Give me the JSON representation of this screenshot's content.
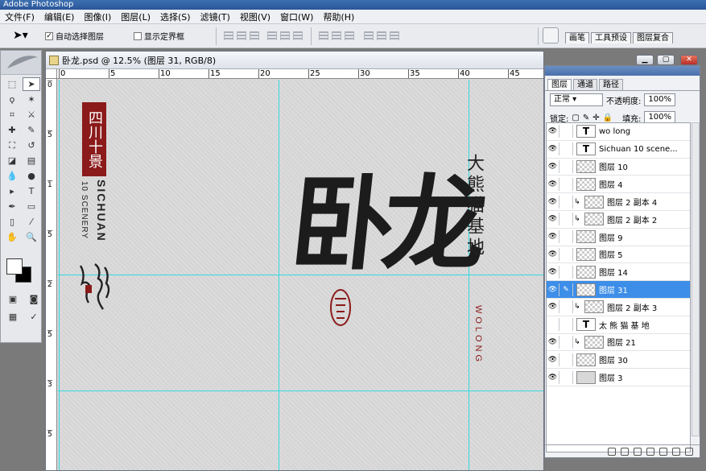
{
  "app": {
    "title": "Adobe Photoshop"
  },
  "menu": [
    "文件(F)",
    "编辑(E)",
    "图像(I)",
    "图层(L)",
    "选择(S)",
    "滤镜(T)",
    "视图(V)",
    "窗口(W)",
    "帮助(H)"
  ],
  "options": {
    "auto_select": "自动选择图层",
    "show_bounds": "显示定界框"
  },
  "palette_tabs": [
    "画笔",
    "工具预设",
    "图层复合"
  ],
  "document": {
    "title": "卧龙.psd @ 12.5% (图层 31, RGB/8)",
    "ruler_h": [
      "0",
      "5",
      "10",
      "15",
      "20",
      "25",
      "30",
      "35",
      "40",
      "45"
    ],
    "ruler_v": [
      "0",
      "5",
      "1",
      "5",
      "2",
      "5",
      "3",
      "5"
    ]
  },
  "artwork": {
    "sichuan_logo": "四川十景",
    "sichuan_en": "SICHUAN",
    "scenery_en": "10 SCENERY",
    "big_chars": "卧龙",
    "side_chars": "大熊猫基地",
    "wolong_en": "WOLONG"
  },
  "layers_panel": {
    "tabs": [
      "图层",
      "通道",
      "路径"
    ],
    "blend_mode": "正常",
    "opacity_label": "不透明度:",
    "opacity_value": "100%",
    "lock_label": "锁定:",
    "fill_label": "填充:",
    "fill_value": "100%",
    "layers": [
      {
        "name": "wo long",
        "type": "text",
        "visible": true
      },
      {
        "name": "Sichuan  10 scene...",
        "type": "text",
        "visible": true
      },
      {
        "name": "图层 10",
        "type": "pixel",
        "visible": true
      },
      {
        "name": "图层 4",
        "type": "pixel",
        "visible": true
      },
      {
        "name": "图层 2 副本 4",
        "type": "pixel",
        "visible": true,
        "clipped": true
      },
      {
        "name": "图层 2 副本 2",
        "type": "pixel",
        "visible": true,
        "clipped": true
      },
      {
        "name": "图层 9",
        "type": "pixel",
        "visible": true
      },
      {
        "name": "图层 5",
        "type": "pixel",
        "visible": true
      },
      {
        "name": "图层 14",
        "type": "pixel",
        "visible": true
      },
      {
        "name": "图层 31",
        "type": "pixel",
        "visible": true,
        "selected": true
      },
      {
        "name": "图层 2 副本 3",
        "type": "pixel",
        "visible": true,
        "clipped": true
      },
      {
        "name": "太 熊 猫 基 地",
        "type": "text",
        "visible": false
      },
      {
        "name": "图层 21",
        "type": "pixel",
        "visible": true,
        "clipped": true
      },
      {
        "name": "图层 30",
        "type": "pixel",
        "visible": true
      },
      {
        "name": "图层 3",
        "type": "fill",
        "visible": true
      }
    ]
  },
  "colors": {
    "accent": "#3c8ee8",
    "guide": "#35d8e0",
    "seal_red": "#8b1a1a"
  }
}
